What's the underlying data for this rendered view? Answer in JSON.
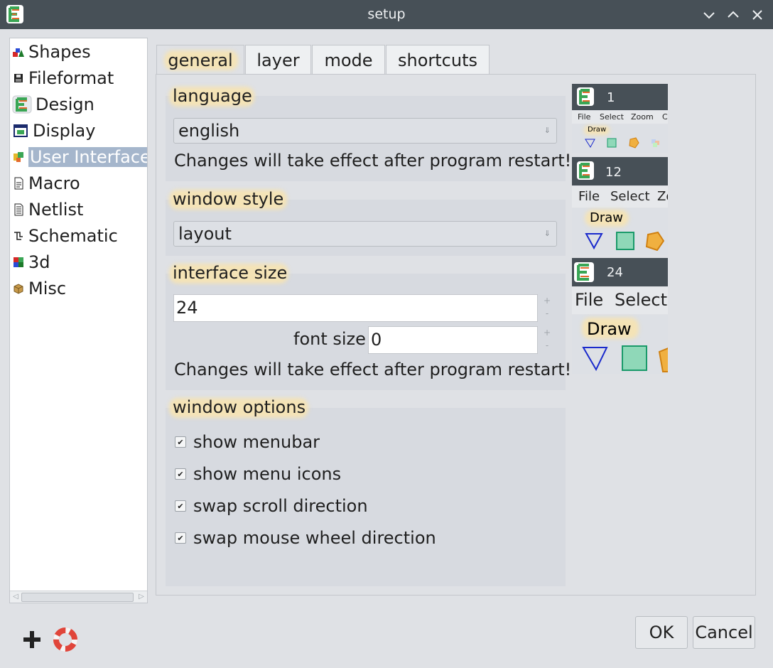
{
  "window": {
    "title": "setup"
  },
  "tree": {
    "items": [
      {
        "label": "Shapes",
        "icon": "shapes-icon"
      },
      {
        "label": "Fileformat",
        "icon": "floppy-icon"
      },
      {
        "label": "Design",
        "icon": "design-icon"
      },
      {
        "label": "Display",
        "icon": "display-icon"
      },
      {
        "label": "User Interface",
        "icon": "user-interface-icon",
        "selected": true
      },
      {
        "label": "Macro",
        "icon": "macro-icon"
      },
      {
        "label": "Netlist",
        "icon": "netlist-icon"
      },
      {
        "label": "Schematic",
        "icon": "schematic-icon"
      },
      {
        "label": "3d",
        "icon": "3d-icon"
      },
      {
        "label": "Misc",
        "icon": "misc-icon"
      }
    ]
  },
  "tabs": [
    {
      "label": "general",
      "active": true
    },
    {
      "label": "layer"
    },
    {
      "label": "mode"
    },
    {
      "label": "shortcuts"
    }
  ],
  "general": {
    "language": {
      "label": "language",
      "value": "english",
      "note": "Changes will take effect after program restart!"
    },
    "window_style": {
      "label": "window style",
      "value": "layout"
    },
    "interface_size": {
      "label": "interface size",
      "value": "24",
      "font_size_label": "font size",
      "font_size_value": "0",
      "note": "Changes will take effect after program restart!",
      "plus": "+",
      "minus": "-"
    },
    "window_options": {
      "label": "window options",
      "options": [
        {
          "label": "show menubar",
          "checked": true
        },
        {
          "label": "show menu icons",
          "checked": true
        },
        {
          "label": "swap scroll direction",
          "checked": true
        },
        {
          "label": "swap mouse wheel direction",
          "checked": true
        }
      ]
    }
  },
  "previews": [
    {
      "size": "1",
      "menu": [
        "File",
        "Select",
        "Zoom",
        "C"
      ],
      "toolbar_label": "Draw"
    },
    {
      "size": "12",
      "menu": [
        "File",
        "Select",
        "Zo"
      ],
      "toolbar_label": "Draw"
    },
    {
      "size": "24",
      "menu": [
        "File",
        "Select"
      ],
      "toolbar_label": "Draw"
    }
  ],
  "buttons": {
    "ok": "OK",
    "cancel": "Cancel"
  },
  "colors": {
    "titlebar": "#475057",
    "selection": "#a5b6cc",
    "highlight": "#f4e3b6",
    "accent_green": "#3aa655",
    "accent_orange": "#e36a2e"
  }
}
